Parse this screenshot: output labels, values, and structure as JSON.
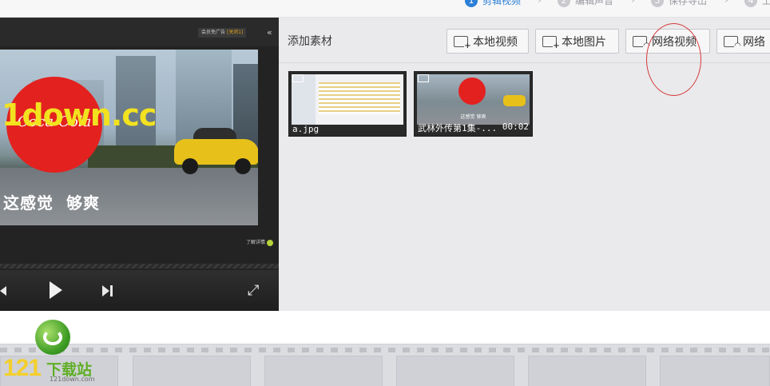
{
  "steps": [
    {
      "num": "1",
      "label": "剪辑视频",
      "active": true
    },
    {
      "num": "2",
      "label": "编辑声音",
      "active": false
    },
    {
      "num": "3",
      "label": "保存导出",
      "active": false
    },
    {
      "num": "4",
      "label": "上",
      "active": false
    }
  ],
  "player": {
    "ad_tag": "会员免广告",
    "ad_close": "[关闭1]",
    "watermark": "1down.cc",
    "logo_script": "Coca-Cola",
    "subtitle_left": "这感觉",
    "subtitle_right": "够爽",
    "detail_link": "了解详情"
  },
  "materials": {
    "title": "添加素材",
    "buttons": {
      "local_video": "本地视频",
      "local_image": "本地图片",
      "net_video": "网络视频",
      "net_image": "网络"
    },
    "items": [
      {
        "name": "a.jpg",
        "duration": ""
      },
      {
        "name": "武林外传第1集-...",
        "duration": "00:02"
      }
    ],
    "thumb2_subtitle": "这感觉 够爽"
  },
  "site_logo": {
    "number": "121",
    "name": "下载站",
    "url": "121down.com"
  },
  "colors": {
    "accent": "#2b7fd6",
    "highlight_circle": "#d43a3a",
    "logo_green": "#5fae26",
    "logo_yellow": "#f4cf2a"
  }
}
